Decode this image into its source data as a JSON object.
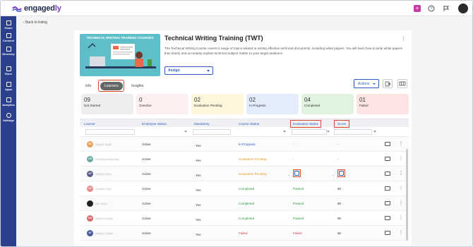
{
  "app": {
    "logo_text_a": "engaged",
    "logo_text_b": "ly"
  },
  "sidebar": {
    "items": [
      {
        "label": "Home"
      },
      {
        "label": "Connect"
      },
      {
        "label": "Directory"
      },
      {
        "label": "Store"
      },
      {
        "label": "Apps"
      },
      {
        "label": "Analytics"
      },
      {
        "label": "Settings"
      }
    ]
  },
  "nav": {
    "back": "Back to listing"
  },
  "course": {
    "banner_title": "TECHNICAL WRITING TRAINING COURSES",
    "title": "Technical Writing Training (TWT)",
    "description": "The Technical Writing Course covers a range of topics related to writing effective technical documents, including white papers. You will learn how to write white papers that clearly and accurately explain technical subject matter to your target audience.",
    "assign_label": "Assign"
  },
  "tabs": [
    {
      "label": "Info"
    },
    {
      "label": "Learners"
    },
    {
      "label": "Insights"
    }
  ],
  "actions_label": "Actions",
  "stats": [
    {
      "n": "09",
      "label": "Not Started",
      "color": "#eeeef0"
    },
    {
      "n": "0",
      "label": "Overdue",
      "color": "#fdeef0"
    },
    {
      "n": "02",
      "label": "Evaluation Pending",
      "color": "#fdf6dc"
    },
    {
      "n": "02",
      "label": "In Progress",
      "color": "#e3ecfb"
    },
    {
      "n": "04",
      "label": "Completed",
      "color": "#dff3df"
    },
    {
      "n": "01",
      "label": "Failed",
      "color": "#fde3e3"
    }
  ],
  "table": {
    "headers": [
      "Learner",
      "Employee Status",
      "Mandatory",
      "Course Status",
      "Evaluation Status",
      "Score"
    ],
    "rows": [
      {
        "initials": "SS",
        "name": "Sophie Scott",
        "emp": "Active",
        "mand": "Yes",
        "course": "In Progress",
        "course_color": "#2b5bbf",
        "eval": "-",
        "eval_color": "#333",
        "score": "-",
        "av_color": "#e8a15a",
        "edit": false
      },
      {
        "initials": "CR",
        "name": "Christina Reynolds",
        "emp": "Active",
        "mand": "Yes",
        "course": "Evaluation Pending",
        "course_color": "#e79a1b",
        "eval": "-",
        "eval_color": "#333",
        "score": "-",
        "av_color": "#6aa7a0",
        "edit": false
      },
      {
        "initials": "AP",
        "name": "Ashley Perry",
        "emp": "Active",
        "mand": "Yes",
        "course": "Evaluation Pending",
        "course_color": "#e79a1b",
        "eval": "-",
        "eval_color": "#333",
        "score": "-",
        "av_color": "#5a5f8a",
        "edit": true
      },
      {
        "initials": "CP",
        "name": "Charlie Potts",
        "emp": "Active",
        "mand": "Yes",
        "course": "Completed",
        "course_color": "#2e9a3a",
        "eval": "Passed",
        "eval_color": "#2e9a3a",
        "score": "80",
        "av_color": "#e88a8a",
        "edit": false
      },
      {
        "initials": "",
        "name": "Ian Snow",
        "emp": "Active",
        "mand": "Yes",
        "course": "Completed",
        "course_color": "#2e9a3a",
        "eval": "Passed",
        "eval_color": "#2e9a3a",
        "score": "90",
        "av_color": "#222",
        "edit": false
      },
      {
        "initials": "GD",
        "name": "Gilbert Dudley",
        "emp": "Active",
        "mand": "Yes",
        "course": "Completed",
        "course_color": "#2e9a3a",
        "eval": "Passed",
        "eval_color": "#2e9a3a",
        "score": "90",
        "av_color": "#d96a6a",
        "edit": false
      },
      {
        "initials": "AT",
        "name": "Ashley Tucker",
        "emp": "Active",
        "mand": "Yes",
        "course": "Failed",
        "course_color": "#d93a3a",
        "eval": "Failed",
        "eval_color": "#d93a3a",
        "score": "50",
        "av_color": "#4a5a9a",
        "edit": false
      }
    ]
  }
}
